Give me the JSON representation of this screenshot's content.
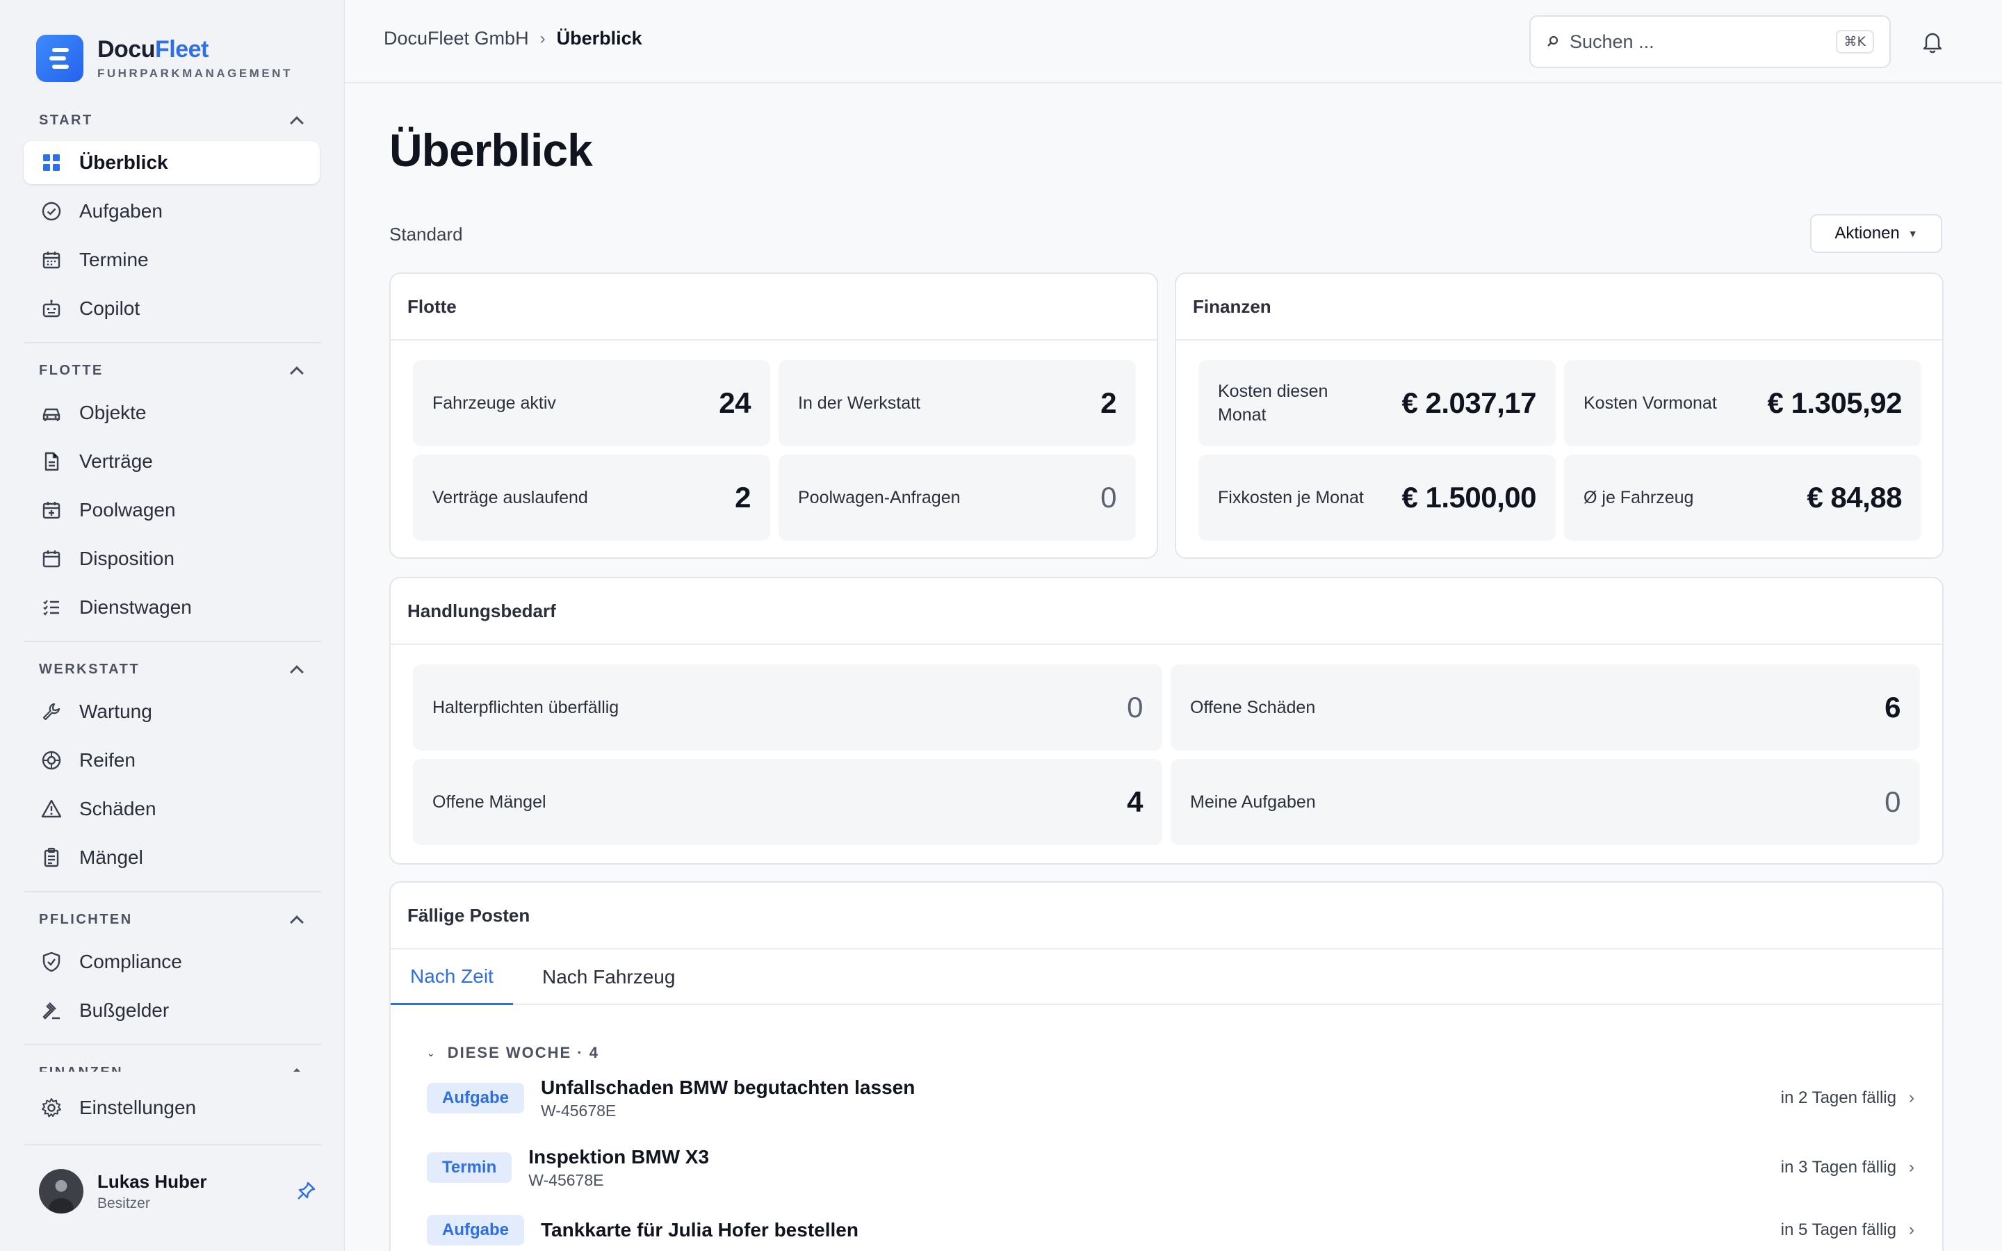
{
  "brand": {
    "name_part1": "Docu",
    "name_part2": "Fleet",
    "subtitle": "FUHRPARKMANAGEMENT"
  },
  "sidebar": {
    "sections": [
      {
        "title": "START",
        "items": [
          "Überblick",
          "Aufgaben",
          "Termine",
          "Copilot"
        ]
      },
      {
        "title": "FLOTTE",
        "items": [
          "Objekte",
          "Verträge",
          "Poolwagen",
          "Disposition",
          "Dienstwagen"
        ]
      },
      {
        "title": "WERKSTATT",
        "items": [
          "Wartung",
          "Reifen",
          "Schäden",
          "Mängel"
        ]
      },
      {
        "title": "PFLICHTEN",
        "items": [
          "Compliance",
          "Bußgelder"
        ]
      },
      {
        "title": "FINANZEN",
        "items": [
          "Einstellungen"
        ]
      }
    ],
    "active_item": "Überblick",
    "user": {
      "name": "Lukas Huber",
      "role": "Besitzer"
    }
  },
  "topbar": {
    "breadcrumb": [
      "DocuFleet GmbH",
      "Überblick"
    ],
    "search": {
      "placeholder": "Suchen ...",
      "shortcut": "⌘K"
    }
  },
  "main": {
    "title": "Überblick",
    "dashboard_name": "Standard",
    "actions_label": "Aktionen",
    "flotte": {
      "title": "Flotte",
      "tiles": [
        {
          "label": "Fahrzeuge aktiv",
          "value": "24"
        },
        {
          "label": "In der Werkstatt",
          "value": "2"
        },
        {
          "label": "Verträge auslaufend",
          "value": "2"
        },
        {
          "label": "Poolwagen-Anfragen",
          "value": "0"
        }
      ]
    },
    "finanzen": {
      "title": "Finanzen",
      "tiles": [
        {
          "label": "Kosten diesen Monat",
          "value": "€ 2.037,17"
        },
        {
          "label": "Kosten Vormonat",
          "value": "€ 1.305,92"
        },
        {
          "label": "Fixkosten je Monat",
          "value": "€ 1.500,00"
        },
        {
          "label": "Ø je Fahrzeug",
          "value": "€ 84,88"
        }
      ]
    },
    "handlungsbedarf": {
      "title": "Handlungsbedarf",
      "tiles": [
        {
          "label": "Halterpflichten überfällig",
          "value": "0"
        },
        {
          "label": "Offene Schäden",
          "value": "6"
        },
        {
          "label": "Offene Mängel",
          "value": "4"
        },
        {
          "label": "Meine Aufgaben",
          "value": "0"
        }
      ]
    },
    "faellig": {
      "title": "Fällige Posten",
      "tabs": [
        "Nach Zeit",
        "Nach Fahrzeug"
      ],
      "group": "DIESE WOCHE · 4",
      "rows": [
        {
          "badge": "Aufgabe",
          "title": "Unfallschaden BMW begutachten lassen",
          "sub": "W-45678E",
          "due": "in 2 Tagen fällig"
        },
        {
          "badge": "Termin",
          "title": "Inspektion BMW X3",
          "sub": "W-45678E",
          "due": "in 3 Tagen fällig"
        },
        {
          "badge": "Aufgabe",
          "title": "Tankkarte für Julia Hofer bestellen",
          "sub": "",
          "due": "in 5 Tagen fällig"
        }
      ]
    }
  },
  "colors": {
    "accent": "#2f6fe4",
    "background": "#f8f9fb",
    "sidebar": "#f1f3f6"
  }
}
